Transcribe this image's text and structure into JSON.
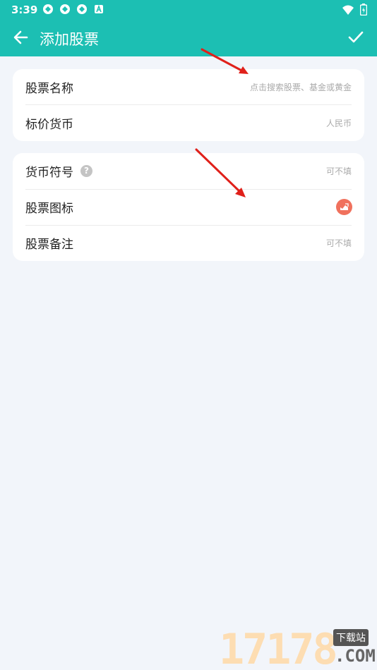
{
  "status_bar": {
    "time": "3:39",
    "notification_icons": [
      "sync-icon",
      "sync-icon",
      "sync-icon",
      "a-icon"
    ],
    "right_icons": [
      "wifi-icon",
      "battery-icon"
    ]
  },
  "app_bar": {
    "title": "添加股票",
    "back_icon": "arrow-left-icon",
    "confirm_icon": "check-icon",
    "color": "#1cbfb3"
  },
  "card1": {
    "rows": [
      {
        "label": "股票名称",
        "value": "点击搜索股票、基金或黄金"
      },
      {
        "label": "标价货币",
        "value": "人民币"
      }
    ]
  },
  "card2": {
    "rows": [
      {
        "label": "货币符号",
        "value": "可不填",
        "help": "?"
      },
      {
        "label": "股票图标",
        "icon": "stock-chart-icon"
      },
      {
        "label": "股票备注",
        "value": "可不填"
      }
    ]
  },
  "watermark": {
    "number": "17178",
    "text": "下载站",
    "domain": ".COM"
  },
  "colors": {
    "accent": "#1cbfb3",
    "background": "#f2f5fa",
    "icon": "#f0715d",
    "arrow": "#e0201a"
  }
}
